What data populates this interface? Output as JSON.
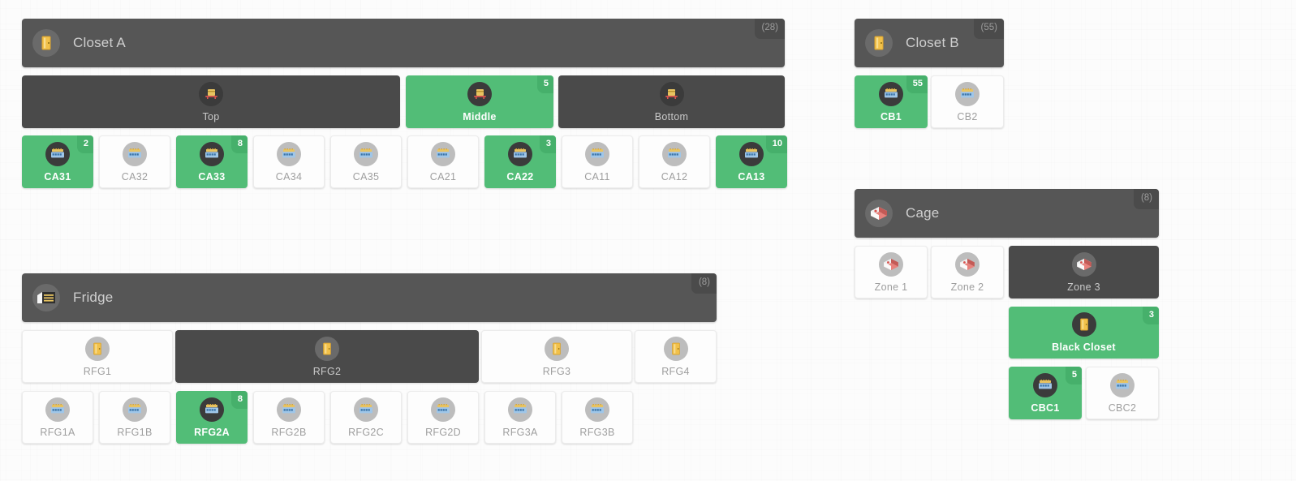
{
  "theme": {
    "accent_green": "#52bd77",
    "panel_dark": "#565656",
    "selected_dark": "#4a4a4a",
    "idle_white": "#fdfdfd",
    "muted_text": "#9e9e9e"
  },
  "groups": [
    {
      "key": "closet_a",
      "title": "Closet A",
      "badge": "(28)",
      "icon": "door-icon",
      "shelves": [
        {
          "label": "Top",
          "icon": "shelf-icon",
          "state": "selected",
          "badge": null
        },
        {
          "label": "Middle",
          "icon": "shelf-icon",
          "state": "active",
          "badge": "5"
        },
        {
          "label": "Bottom",
          "icon": "shelf-icon",
          "state": "selected",
          "badge": null
        }
      ],
      "devices": [
        {
          "label": "CA31",
          "icon": "switch-icon",
          "state": "active",
          "badge": "2"
        },
        {
          "label": "CA32",
          "icon": "switch-icon",
          "state": "idle",
          "badge": null
        },
        {
          "label": "CA33",
          "icon": "switch-icon",
          "state": "active",
          "badge": "8"
        },
        {
          "label": "CA34",
          "icon": "switch-icon",
          "state": "idle",
          "badge": null
        },
        {
          "label": "CA35",
          "icon": "switch-icon",
          "state": "idle",
          "badge": null
        },
        {
          "label": "CA21",
          "icon": "switch-icon",
          "state": "idle",
          "badge": null
        },
        {
          "label": "CA22",
          "icon": "switch-icon",
          "state": "active",
          "badge": "3"
        },
        {
          "label": "CA11",
          "icon": "switch-icon",
          "state": "idle",
          "badge": null
        },
        {
          "label": "CA12",
          "icon": "switch-icon",
          "state": "idle",
          "badge": null
        },
        {
          "label": "CA13",
          "icon": "switch-icon",
          "state": "active",
          "badge": "10"
        }
      ]
    },
    {
      "key": "closet_b",
      "title": "Closet B",
      "badge": "(55)",
      "icon": "door-icon",
      "devices": [
        {
          "label": "CB1",
          "icon": "switch-icon",
          "state": "active",
          "badge": "55"
        },
        {
          "label": "CB2",
          "icon": "switch-icon",
          "state": "idle",
          "badge": null
        }
      ]
    },
    {
      "key": "fridge",
      "title": "Fridge",
      "badge": "(8)",
      "icon": "warehouse-icon",
      "zones": [
        {
          "label": "RFG1",
          "icon": "door-icon",
          "state": "idle",
          "badge": null
        },
        {
          "label": "RFG2",
          "icon": "door-icon",
          "state": "selected",
          "badge": null
        },
        {
          "label": "RFG3",
          "icon": "door-icon",
          "state": "idle",
          "badge": null
        },
        {
          "label": "RFG4",
          "icon": "door-icon",
          "state": "idle",
          "badge": null
        }
      ],
      "devices": [
        {
          "label": "RFG1A",
          "icon": "switch-icon",
          "state": "idle",
          "badge": null
        },
        {
          "label": "RFG1B",
          "icon": "switch-icon",
          "state": "idle",
          "badge": null
        },
        {
          "label": "RFG2A",
          "icon": "switch-icon",
          "state": "active",
          "badge": "8"
        },
        {
          "label": "RFG2B",
          "icon": "switch-icon",
          "state": "idle",
          "badge": null
        },
        {
          "label": "RFG2C",
          "icon": "switch-icon",
          "state": "idle",
          "badge": null
        },
        {
          "label": "RFG2D",
          "icon": "switch-icon",
          "state": "idle",
          "badge": null
        },
        {
          "label": "RFG3A",
          "icon": "switch-icon",
          "state": "idle",
          "badge": null
        },
        {
          "label": "RFG3B",
          "icon": "switch-icon",
          "state": "idle",
          "badge": null
        }
      ]
    },
    {
      "key": "cage",
      "title": "Cage",
      "badge": "(8)",
      "icon": "cage-icon",
      "zones": [
        {
          "label": "Zone 1",
          "icon": "cage-icon",
          "state": "idle",
          "badge": null
        },
        {
          "label": "Zone 2",
          "icon": "cage-icon",
          "state": "idle",
          "badge": null
        },
        {
          "label": "Zone 3",
          "icon": "cage-icon",
          "state": "selected",
          "badge": null
        }
      ],
      "subgroup": {
        "label": "Black Closet",
        "icon": "door-icon",
        "state": "active",
        "badge": "3"
      },
      "devices": [
        {
          "label": "CBC1",
          "icon": "switch-icon",
          "state": "active",
          "badge": "5"
        },
        {
          "label": "CBC2",
          "icon": "switch-icon",
          "state": "idle",
          "badge": null
        }
      ]
    }
  ]
}
